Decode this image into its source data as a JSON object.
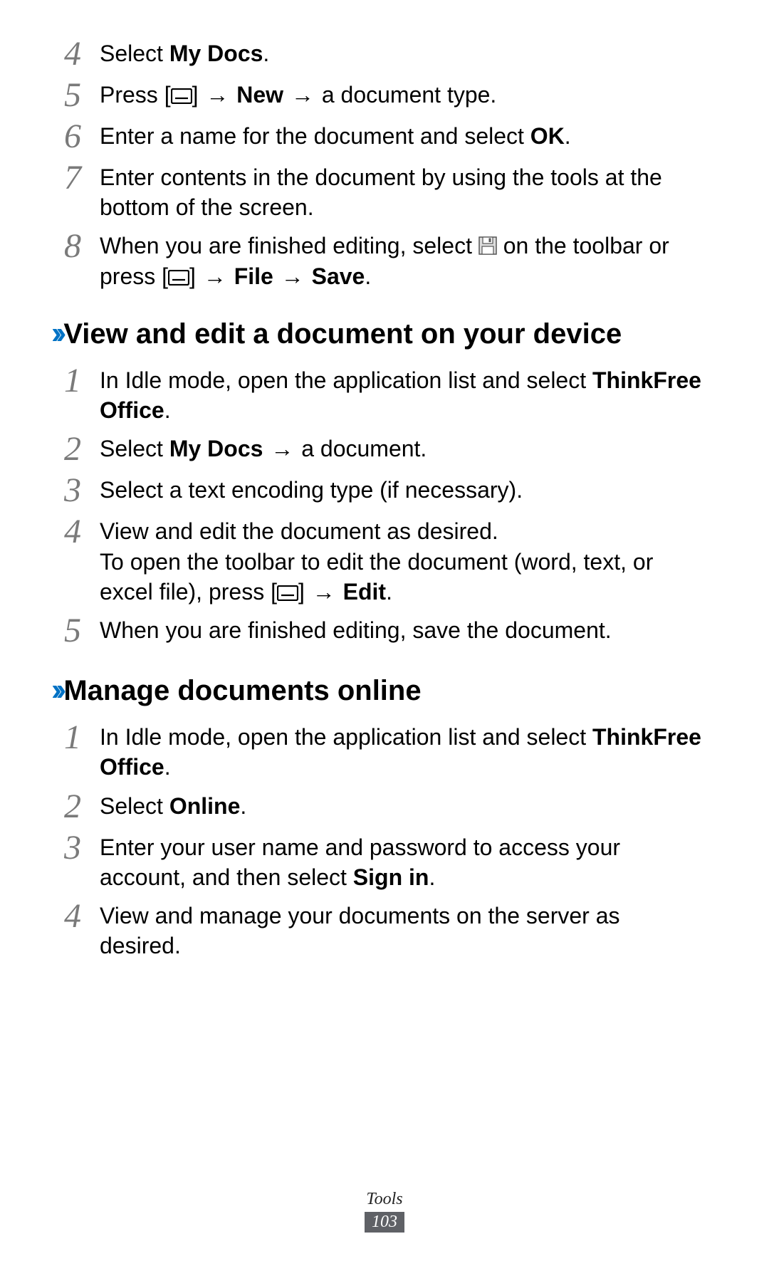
{
  "topSteps": [
    {
      "num": "4",
      "parts": [
        {
          "t": "Select "
        },
        {
          "t": "My Docs",
          "b": true
        },
        {
          "t": "."
        }
      ]
    },
    {
      "num": "5",
      "parts": [
        {
          "t": "Press ["
        },
        {
          "icon": "menu"
        },
        {
          "t": "] "
        },
        {
          "t": "→",
          "cls": "arrow"
        },
        {
          "t": " "
        },
        {
          "t": "New",
          "b": true
        },
        {
          "t": " "
        },
        {
          "t": "→",
          "cls": "arrow"
        },
        {
          "t": " a document type."
        }
      ]
    },
    {
      "num": "6",
      "parts": [
        {
          "t": "Enter a name for the document and select "
        },
        {
          "t": "OK",
          "b": true
        },
        {
          "t": "."
        }
      ]
    },
    {
      "num": "7",
      "parts": [
        {
          "t": "Enter contents in the document by using the tools at the bottom of the screen."
        }
      ]
    },
    {
      "num": "8",
      "parts": [
        {
          "t": "When you are finished editing, select "
        },
        {
          "icon": "save"
        },
        {
          "t": " on the toolbar or press ["
        },
        {
          "icon": "menu"
        },
        {
          "t": "] "
        },
        {
          "t": "→",
          "cls": "arrow"
        },
        {
          "t": " "
        },
        {
          "t": "File",
          "b": true
        },
        {
          "t": " "
        },
        {
          "t": "→",
          "cls": "arrow"
        },
        {
          "t": " "
        },
        {
          "t": "Save",
          "b": true
        },
        {
          "t": "."
        }
      ]
    }
  ],
  "sectionA": {
    "title": "View and edit a document on your device",
    "steps": [
      {
        "num": "1",
        "parts": [
          {
            "t": "In Idle mode, open the application list and select "
          },
          {
            "t": "ThinkFree Office",
            "b": true
          },
          {
            "t": "."
          }
        ]
      },
      {
        "num": "2",
        "parts": [
          {
            "t": "Select "
          },
          {
            "t": "My Docs",
            "b": true
          },
          {
            "t": " "
          },
          {
            "t": "→",
            "cls": "arrow"
          },
          {
            "t": " a document."
          }
        ]
      },
      {
        "num": "3",
        "parts": [
          {
            "t": "Select a text encoding type (if necessary)."
          }
        ]
      },
      {
        "num": "4",
        "parts": [
          {
            "t": "View and edit the document as desired."
          }
        ],
        "extra": [
          {
            "t": "To open the toolbar to edit the document (word, text, or excel file), press ["
          },
          {
            "icon": "menu"
          },
          {
            "t": "] "
          },
          {
            "t": "→",
            "cls": "arrow"
          },
          {
            "t": " "
          },
          {
            "t": "Edit",
            "b": true
          },
          {
            "t": "."
          }
        ]
      },
      {
        "num": "5",
        "parts": [
          {
            "t": "When you are finished editing, save the document."
          }
        ]
      }
    ]
  },
  "sectionB": {
    "title": "Manage documents online",
    "steps": [
      {
        "num": "1",
        "parts": [
          {
            "t": "In Idle mode, open the application list and select "
          },
          {
            "t": "ThinkFree Office",
            "b": true
          },
          {
            "t": "."
          }
        ]
      },
      {
        "num": "2",
        "parts": [
          {
            "t": "Select "
          },
          {
            "t": "Online",
            "b": true
          },
          {
            "t": "."
          }
        ]
      },
      {
        "num": "3",
        "parts": [
          {
            "t": "Enter your user name and password to access your account, and then select "
          },
          {
            "t": "Sign in",
            "b": true
          },
          {
            "t": "."
          }
        ]
      },
      {
        "num": "4",
        "parts": [
          {
            "t": "View and manage your documents on the server as desired."
          }
        ]
      }
    ]
  },
  "footer": {
    "section": "Tools",
    "page": "103"
  },
  "chevron": "››"
}
